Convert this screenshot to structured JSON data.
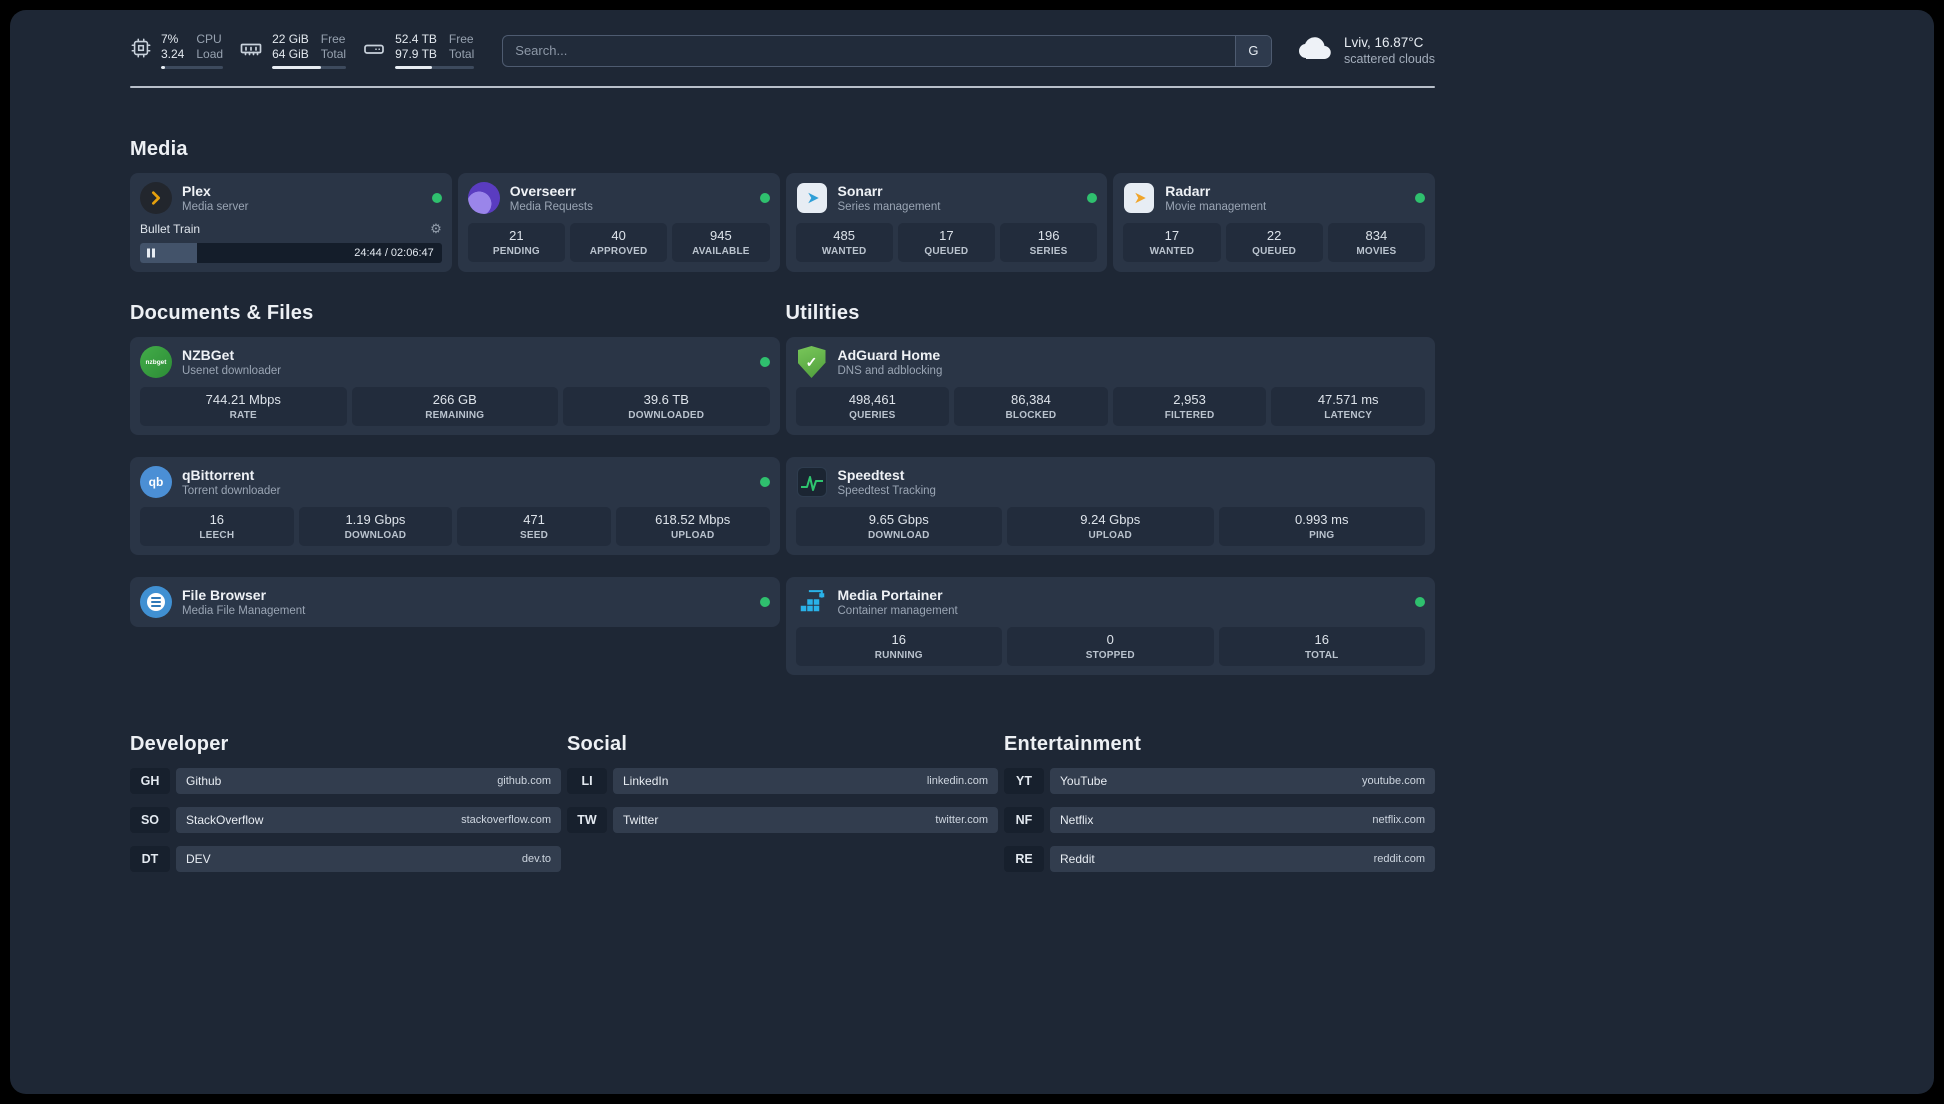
{
  "topbar": {
    "cpu": {
      "value_top": "7%",
      "value_bottom": "3.24",
      "label_top": "CPU",
      "label_bottom": "Load",
      "fill": "7%"
    },
    "memory": {
      "value_top": "22 GiB",
      "value_bottom": "64 GiB",
      "label_top": "Free",
      "label_bottom": "Total",
      "fill": "66%"
    },
    "disk": {
      "value_top": "52.4 TB",
      "value_bottom": "97.9 TB",
      "label_top": "Free",
      "label_bottom": "Total",
      "fill": "47%"
    },
    "search": {
      "placeholder": "Search...",
      "button_label": "G"
    },
    "weather": {
      "location": "Lviv, 16.87°C",
      "condition": "scattered clouds"
    }
  },
  "media": {
    "title": "Media",
    "plex": {
      "name": "Plex",
      "subtitle": "Media server",
      "now_playing": "Bullet Train",
      "time": "24:44 / 02:06:47",
      "progress": "19%"
    },
    "overseerr": {
      "name": "Overseerr",
      "subtitle": "Media Requests",
      "stats": [
        {
          "value": "21",
          "label": "PENDING"
        },
        {
          "value": "40",
          "label": "APPROVED"
        },
        {
          "value": "945",
          "label": "AVAILABLE"
        }
      ]
    },
    "sonarr": {
      "name": "Sonarr",
      "subtitle": "Series management",
      "stats": [
        {
          "value": "485",
          "label": "WANTED"
        },
        {
          "value": "17",
          "label": "QUEUED"
        },
        {
          "value": "196",
          "label": "SERIES"
        }
      ]
    },
    "radarr": {
      "name": "Radarr",
      "subtitle": "Movie management",
      "stats": [
        {
          "value": "17",
          "label": "WANTED"
        },
        {
          "value": "22",
          "label": "QUEUED"
        },
        {
          "value": "834",
          "label": "MOVIES"
        }
      ]
    }
  },
  "documents": {
    "title": "Documents & Files",
    "nzbget": {
      "name": "NZBGet",
      "subtitle": "Usenet downloader",
      "icon_text": "nzbget",
      "stats": [
        {
          "value": "744.21 Mbps",
          "label": "RATE"
        },
        {
          "value": "266 GB",
          "label": "REMAINING"
        },
        {
          "value": "39.6 TB",
          "label": "DOWNLOADED"
        }
      ]
    },
    "qbittorrent": {
      "name": "qBittorrent",
      "subtitle": "Torrent downloader",
      "icon_text": "qb",
      "stats": [
        {
          "value": "16",
          "label": "LEECH"
        },
        {
          "value": "1.19 Gbps",
          "label": "DOWNLOAD"
        },
        {
          "value": "471",
          "label": "SEED"
        },
        {
          "value": "618.52 Mbps",
          "label": "UPLOAD"
        }
      ]
    },
    "filebrowser": {
      "name": "File Browser",
      "subtitle": "Media File Management"
    }
  },
  "utilities": {
    "title": "Utilities",
    "adguard": {
      "name": "AdGuard Home",
      "subtitle": "DNS and adblocking",
      "icon_check": "✓",
      "stats": [
        {
          "value": "498,461",
          "label": "QUERIES"
        },
        {
          "value": "86,384",
          "label": "BLOCKED"
        },
        {
          "value": "2,953",
          "label": "FILTERED"
        },
        {
          "value": "47.571 ms",
          "label": "LATENCY"
        }
      ]
    },
    "speedtest": {
      "name": "Speedtest",
      "subtitle": "Speedtest Tracking",
      "stats": [
        {
          "value": "9.65 Gbps",
          "label": "DOWNLOAD"
        },
        {
          "value": "9.24 Gbps",
          "label": "UPLOAD"
        },
        {
          "value": "0.993 ms",
          "label": "PING"
        }
      ]
    },
    "portainer": {
      "name": "Media Portainer",
      "subtitle": "Container management",
      "stats": [
        {
          "value": "16",
          "label": "RUNNING"
        },
        {
          "value": "0",
          "label": "STOPPED"
        },
        {
          "value": "16",
          "label": "TOTAL"
        }
      ]
    }
  },
  "bookmarks": {
    "developer": {
      "title": "Developer",
      "items": [
        {
          "abbr": "GH",
          "name": "Github",
          "url": "github.com"
        },
        {
          "abbr": "SO",
          "name": "StackOverflow",
          "url": "stackoverflow.com"
        },
        {
          "abbr": "DT",
          "name": "DEV",
          "url": "dev.to"
        }
      ]
    },
    "social": {
      "title": "Social",
      "items": [
        {
          "abbr": "LI",
          "name": "LinkedIn",
          "url": "linkedin.com"
        },
        {
          "abbr": "TW",
          "name": "Twitter",
          "url": "twitter.com"
        }
      ]
    },
    "entertainment": {
      "title": "Entertainment",
      "items": [
        {
          "abbr": "YT",
          "name": "YouTube",
          "url": "youtube.com"
        },
        {
          "abbr": "NF",
          "name": "Netflix",
          "url": "netflix.com"
        },
        {
          "abbr": "RE",
          "name": "Reddit",
          "url": "reddit.com"
        }
      ]
    }
  }
}
